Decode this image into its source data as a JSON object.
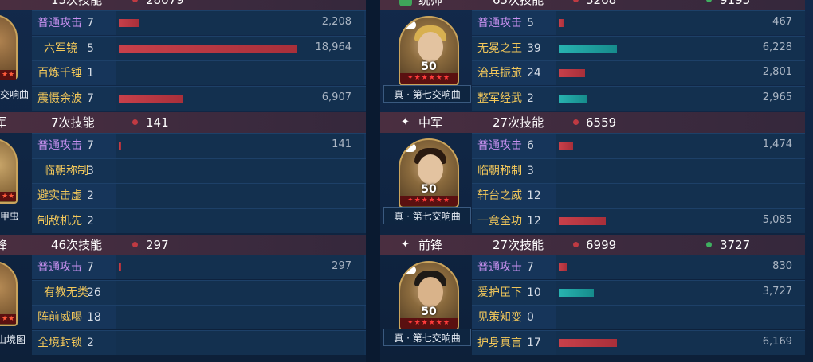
{
  "left": {
    "groups": [
      {
        "header": {
          "role": "",
          "skill_count": "13次技能",
          "damage": "28079"
        },
        "formation": "交响曲",
        "rows": [
          {
            "name": "普通攻击",
            "type": "atk",
            "count": "7",
            "damage": "2,208",
            "bar": 0.115,
            "color": "red"
          },
          {
            "name": "六军镜",
            "type": "sk",
            "count": "5",
            "damage": "18,964",
            "bar": 1.0,
            "color": "red"
          },
          {
            "name": "百炼千锤",
            "type": "sk",
            "count": "1",
            "damage": "",
            "bar": 0,
            "color": "red"
          },
          {
            "name": "震慑余波",
            "type": "sk",
            "count": "7",
            "damage": "6,907",
            "bar": 0.36,
            "color": "red"
          }
        ]
      },
      {
        "header": {
          "role": "军",
          "skill_count": "7次技能",
          "damage": "141"
        },
        "formation": "甲虫",
        "rows": [
          {
            "name": "普通攻击",
            "type": "atk",
            "count": "7",
            "damage": "141",
            "bar": 0.01,
            "color": "red"
          },
          {
            "name": "临朝称制",
            "type": "sk",
            "count": "3",
            "damage": "",
            "bar": 0,
            "color": "red"
          },
          {
            "name": "避实击虚",
            "type": "sk",
            "count": "2",
            "damage": "",
            "bar": 0,
            "color": "red"
          },
          {
            "name": "制敌机先",
            "type": "sk",
            "count": "2",
            "damage": "",
            "bar": 0,
            "color": "red"
          }
        ]
      },
      {
        "header": {
          "role": "锋",
          "skill_count": "46次技能",
          "damage": "297"
        },
        "formation": "山境图",
        "rows": [
          {
            "name": "普通攻击",
            "type": "atk",
            "count": "7",
            "damage": "297",
            "bar": 0.012,
            "color": "red"
          },
          {
            "name": "有教无类",
            "type": "sk",
            "count": "26",
            "damage": "",
            "bar": 0,
            "color": "red"
          },
          {
            "name": "阵前威喝",
            "type": "sk",
            "count": "18",
            "damage": "",
            "bar": 0,
            "color": "red"
          },
          {
            "name": "全境封锁",
            "type": "sk",
            "count": "2",
            "damage": "",
            "bar": 0,
            "color": "red"
          }
        ]
      }
    ]
  },
  "right": {
    "groups": [
      {
        "header": {
          "role": "统帅",
          "skill_count": "65次技能",
          "damage": "3268",
          "heal": "9193"
        },
        "level": "50",
        "formation": "真 · 第七交响曲",
        "rows": [
          {
            "name": "普通攻击",
            "type": "atk",
            "count": "5",
            "damage": "467",
            "bar": 0.03,
            "color": "red"
          },
          {
            "name": "无冕之王",
            "type": "sk",
            "count": "39",
            "damage": "6,228",
            "bar": 0.33,
            "color": "teal"
          },
          {
            "name": "治兵振旅",
            "type": "sk",
            "count": "24",
            "damage": "2,801",
            "bar": 0.15,
            "color": "red"
          },
          {
            "name": "整军经武",
            "type": "sk",
            "count": "2",
            "damage": "2,965",
            "bar": 0.16,
            "color": "teal"
          }
        ]
      },
      {
        "header": {
          "role": "中军",
          "skill_count": "27次技能",
          "damage": "6559",
          "heal": ""
        },
        "level": "50",
        "formation": "真 · 第七交响曲",
        "rows": [
          {
            "name": "普通攻击",
            "type": "atk",
            "count": "6",
            "damage": "1,474",
            "bar": 0.08,
            "color": "red"
          },
          {
            "name": "临朝称制",
            "type": "sk",
            "count": "3",
            "damage": "",
            "bar": 0,
            "color": "red"
          },
          {
            "name": "轩台之威",
            "type": "sk",
            "count": "12",
            "damage": "",
            "bar": 0,
            "color": "red"
          },
          {
            "name": "一竟全功",
            "type": "sk",
            "count": "12",
            "damage": "5,085",
            "bar": 0.27,
            "color": "red"
          }
        ]
      },
      {
        "header": {
          "role": "前锋",
          "skill_count": "27次技能",
          "damage": "6999",
          "heal": "3727"
        },
        "level": "50",
        "formation": "真 · 第七交响曲",
        "rows": [
          {
            "name": "普通攻击",
            "type": "atk",
            "count": "7",
            "damage": "830",
            "bar": 0.045,
            "color": "red"
          },
          {
            "name": "爱护臣下",
            "type": "sk",
            "count": "10",
            "damage": "3,727",
            "bar": 0.2,
            "color": "teal"
          },
          {
            "name": "见策知变",
            "type": "sk",
            "count": "0",
            "damage": "",
            "bar": 0,
            "color": "red"
          },
          {
            "name": "护身真言",
            "type": "sk",
            "count": "17",
            "damage": "6,169",
            "bar": 0.33,
            "color": "red"
          }
        ]
      }
    ]
  },
  "colors": {
    "attack": "#c891f0",
    "skill": "#f3c85a",
    "red_bar": "#c8404a",
    "teal_bar": "#28b3b0",
    "header_bg": "#4a2e40"
  }
}
